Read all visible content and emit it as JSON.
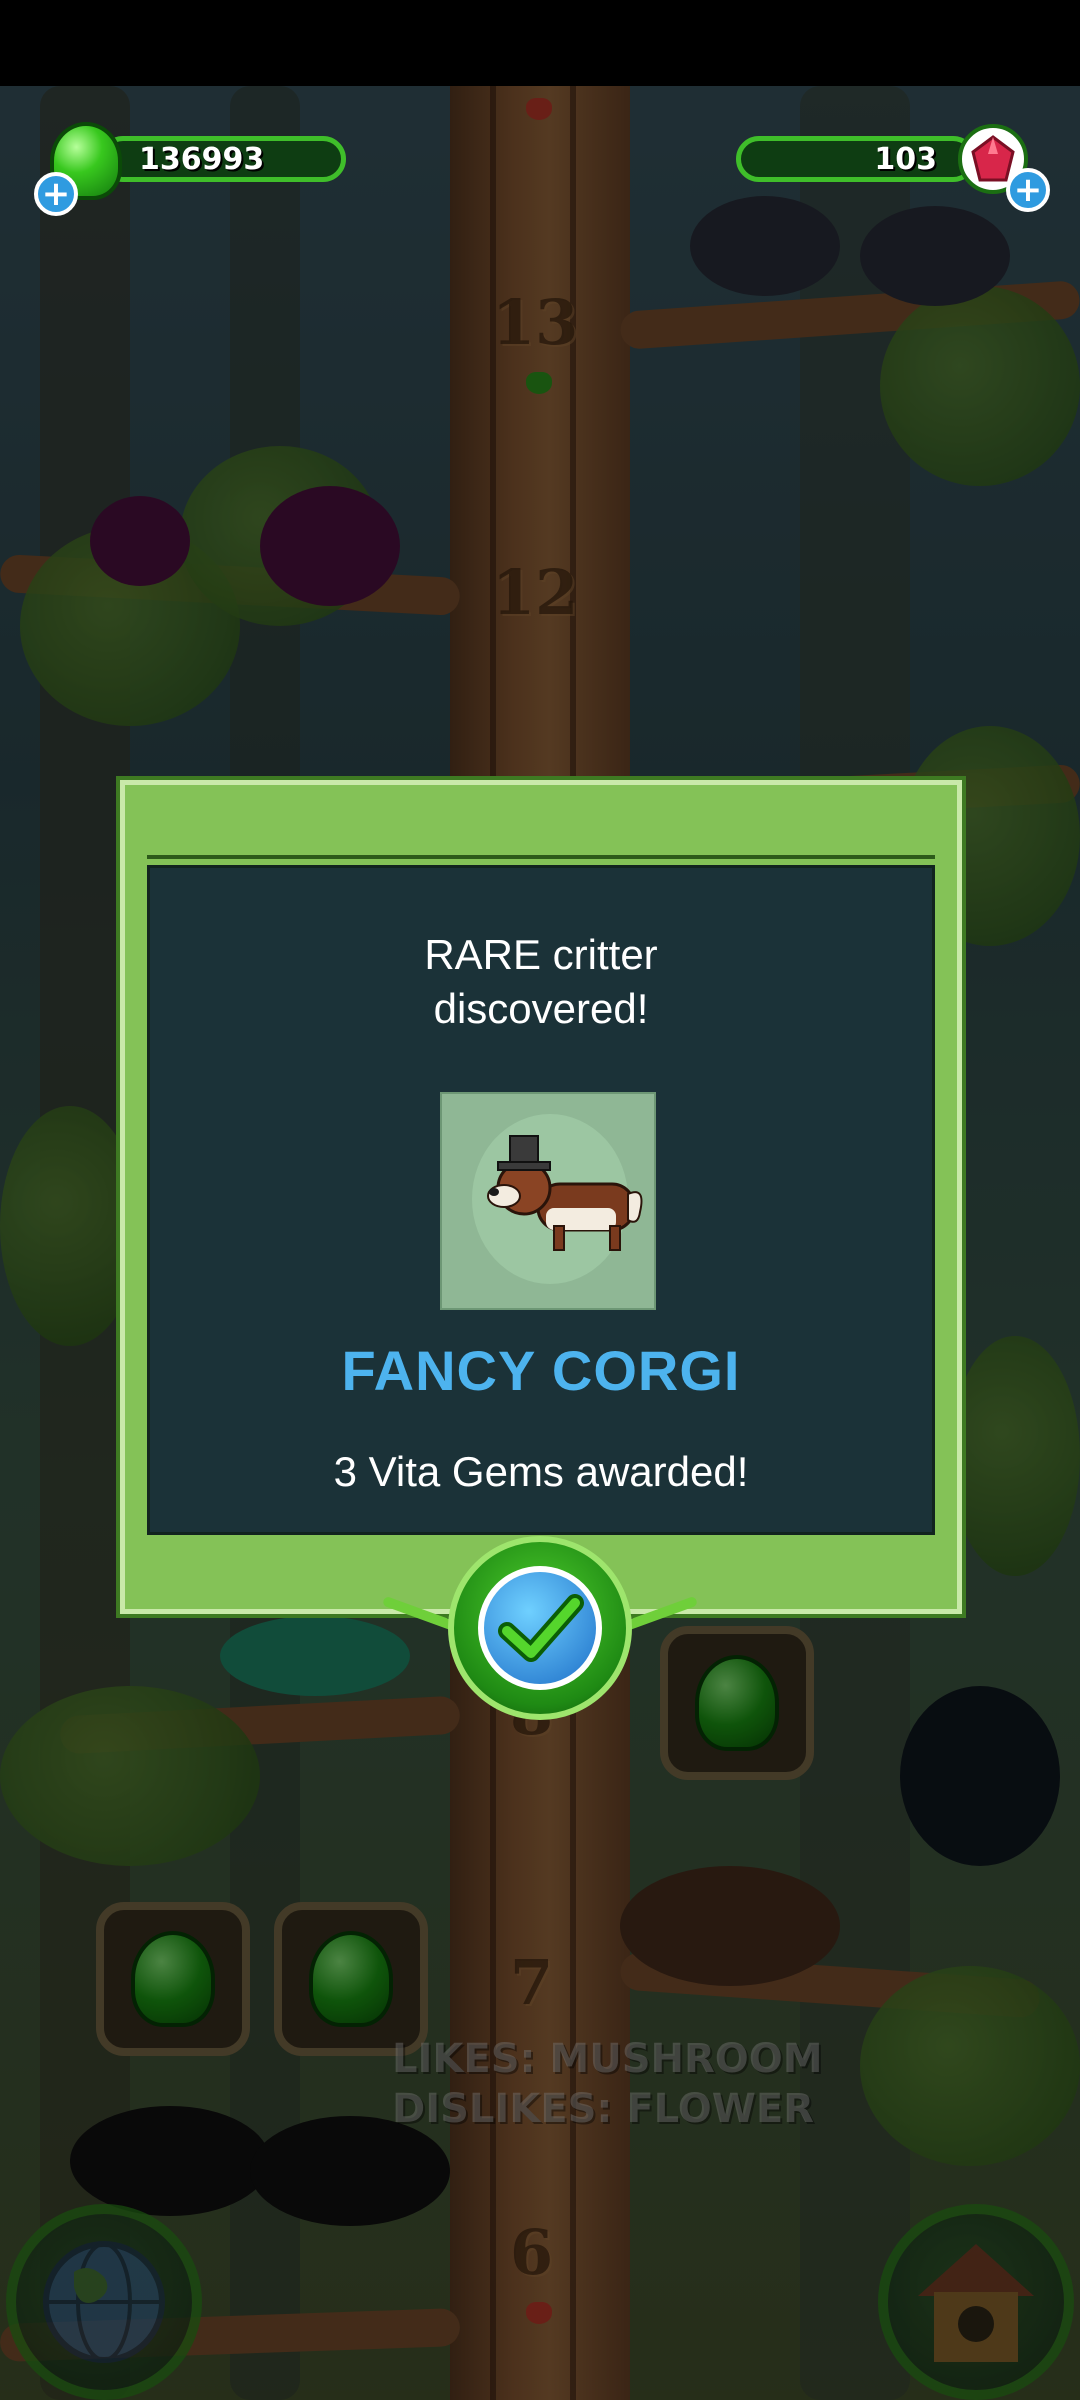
{
  "hud": {
    "jelly_count": "136993",
    "gem_count": "103"
  },
  "tree": {
    "level_numbers": [
      "13",
      "12",
      "8",
      "7",
      "6"
    ]
  },
  "dialog": {
    "headline": "RARE critter\ndiscovered!",
    "critter_name": "FANCY CORGI",
    "reward": "3 Vita Gems awarded!"
  },
  "critter_info": {
    "likes": "LIKES: MUSHROOM",
    "dislikes": "DISLIKES: FLOWER"
  },
  "icons": {
    "jelly": "green-jelly-icon",
    "gem": "red-vita-gem-icon",
    "plus": "plus-icon",
    "confirm": "checkmark-icon",
    "world": "globe-icon",
    "home": "birdhouse-icon"
  },
  "colors": {
    "accent_green": "#84c257",
    "dialog_bg": "#1b3238",
    "critter_name": "#4db3ee"
  }
}
